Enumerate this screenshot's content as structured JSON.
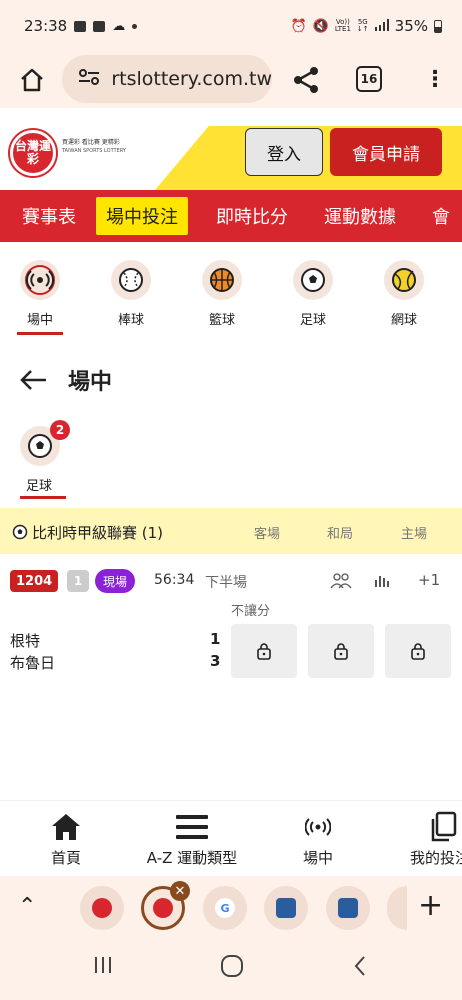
{
  "status": {
    "time": "23:38",
    "network_top": "Vo))",
    "network_bottom": "LTE1",
    "gen_top": "5G",
    "gen_bottom": "↓↑",
    "battery": "35%"
  },
  "browser": {
    "url_text": "rtslottery.com.tw",
    "tab_count": "16"
  },
  "site": {
    "logo_text": "台灣運彩",
    "slogan": "買運彩  看比賽  更精彩",
    "logo_sub": "TAIWAN SPORTS LOTTERY",
    "login": "登入",
    "register": "會員申請"
  },
  "main_nav": [
    "賽事表",
    "場中投注",
    "即時比分",
    "運動數據",
    "會"
  ],
  "main_nav_active": 1,
  "sport_tabs": [
    {
      "label": "場中",
      "icon": "live-broadcast-icon",
      "active": true
    },
    {
      "label": "棒球",
      "icon": "baseball-icon",
      "active": false
    },
    {
      "label": "籃球",
      "icon": "basketball-icon",
      "active": false
    },
    {
      "label": "足球",
      "icon": "soccer-ball-icon",
      "active": false
    },
    {
      "label": "網球",
      "icon": "tennis-ball-icon",
      "active": false
    }
  ],
  "page": {
    "title": "場中"
  },
  "sub_sport": {
    "label": "足球",
    "badge": "2"
  },
  "league": {
    "name": "比利時甲級聯賽 (1)",
    "col_away": "客場",
    "col_draw": "和局",
    "col_home": "主場"
  },
  "match": {
    "code": "1204",
    "num": "1",
    "live": "現場",
    "time": "56:34",
    "half": "下半場",
    "more": "+1",
    "market": "不讓分",
    "team1": "根特",
    "team2": "布魯日",
    "score1": "1",
    "score2": "3"
  },
  "bottom_nav": [
    {
      "label": "首頁",
      "icon": "home-icon"
    },
    {
      "label": "A-Z 運動類型",
      "icon": "menu-icon"
    },
    {
      "label": "場中",
      "icon": "live-icon"
    },
    {
      "label": "我的投注",
      "icon": "copy-icon"
    }
  ],
  "colors": {
    "brand_red": "#d8262e",
    "highlight_yellow": "#ffe600",
    "league_bg": "#fff6b8",
    "live_purple": "#8b22d6"
  }
}
